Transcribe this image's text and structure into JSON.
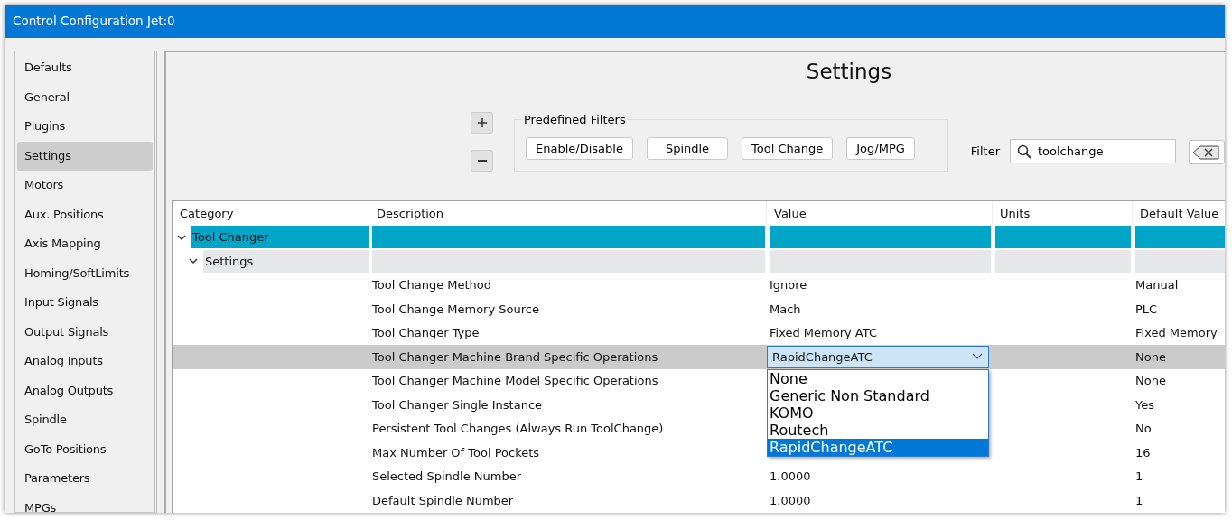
{
  "window": {
    "title": "Control Configuration Jet:0"
  },
  "sidebar": {
    "items": [
      {
        "label": "Defaults",
        "selected": false
      },
      {
        "label": "General",
        "selected": false
      },
      {
        "label": "Plugins",
        "selected": false
      },
      {
        "label": "Settings",
        "selected": true
      },
      {
        "label": "Motors",
        "selected": false
      },
      {
        "label": "Aux. Positions",
        "selected": false
      },
      {
        "label": "Axis Mapping",
        "selected": false
      },
      {
        "label": "Homing/SoftLimits",
        "selected": false
      },
      {
        "label": "Input Signals",
        "selected": false
      },
      {
        "label": "Output Signals",
        "selected": false
      },
      {
        "label": "Analog Inputs",
        "selected": false
      },
      {
        "label": "Analog Outputs",
        "selected": false
      },
      {
        "label": "Spindle",
        "selected": false
      },
      {
        "label": "GoTo Positions",
        "selected": false
      },
      {
        "label": "Parameters",
        "selected": false
      },
      {
        "label": "MPGs",
        "selected": false
      }
    ]
  },
  "panel": {
    "title": "Settings",
    "predefined_filters": {
      "legend": "Predefined Filters",
      "buttons": [
        "Enable/Disable",
        "Spindle",
        "Tool Change",
        "Jog/MPG"
      ]
    },
    "filter": {
      "label": "Filter",
      "value": "toolchange"
    },
    "table": {
      "columns": [
        "Category",
        "Description",
        "Value",
        "Units",
        "Default Value"
      ],
      "tree": [
        {
          "category": "Tool Changer",
          "expanded": true,
          "children": [
            {
              "category": "Settings",
              "expanded": true,
              "rows": [
                {
                  "kind": "text",
                  "description": "Tool Change Method",
                  "value": "Ignore",
                  "default_value": "Manual",
                  "selected": false
                },
                {
                  "kind": "text",
                  "description": "Tool Change Memory Source",
                  "value": "Mach",
                  "default_value": "PLC",
                  "selected": false
                },
                {
                  "kind": "text",
                  "description": "Tool Changer Type",
                  "value": "Fixed Memory ATC",
                  "default_value": "Fixed Memory",
                  "selected": false
                },
                {
                  "kind": "dropdown",
                  "description": "Tool Changer Machine Brand Specific Operations",
                  "dropdown": {
                    "value": "RapidChangeATC",
                    "expanded": true,
                    "options": [
                      {
                        "label": "None",
                        "selected": false
                      },
                      {
                        "label": "Generic Non Standard",
                        "selected": false
                      },
                      {
                        "label": "KOMO",
                        "selected": false
                      },
                      {
                        "label": "Routech",
                        "selected": false
                      },
                      {
                        "label": "RapidChangeATC",
                        "selected": true
                      }
                    ]
                  },
                  "default_value": "None",
                  "selected": true
                },
                {
                  "kind": "text",
                  "description": "Tool Changer Machine Model Specific Operations",
                  "default_value": "None",
                  "selected": false
                },
                {
                  "kind": "text",
                  "description": "Tool Changer Single Instance",
                  "default_value": "Yes",
                  "selected": false
                },
                {
                  "kind": "text",
                  "description": "Persistent Tool Changes (Always Run ToolChange)",
                  "default_value": "No",
                  "selected": false
                },
                {
                  "kind": "text",
                  "description": "Max Number Of Tool Pockets",
                  "default_value": "16",
                  "selected": false
                },
                {
                  "kind": "text",
                  "description": "Selected Spindle Number",
                  "value": "1.0000",
                  "default_value": "1",
                  "selected": false
                },
                {
                  "kind": "text",
                  "description": "Default Spindle Number",
                  "value": "1.0000",
                  "default_value": "1",
                  "selected": false
                }
              ]
            }
          ]
        }
      ]
    }
  }
}
